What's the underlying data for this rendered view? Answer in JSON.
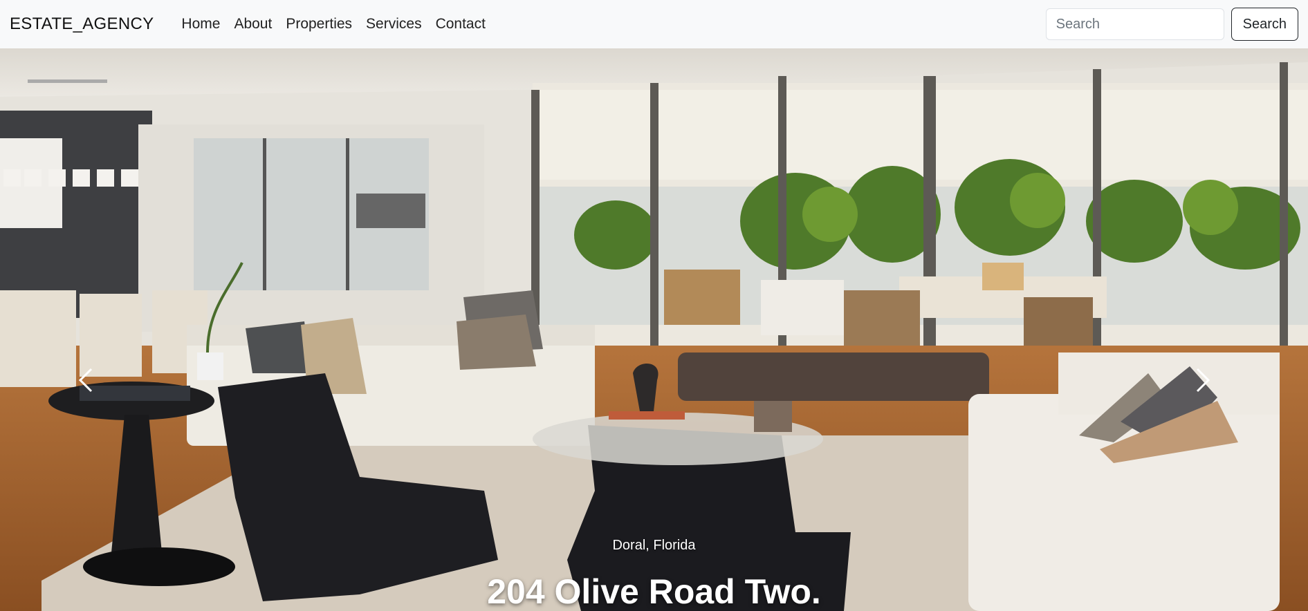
{
  "navbar": {
    "brand": "ESTATE_AGENCY",
    "links": [
      "Home",
      "About",
      "Properties",
      "Services",
      "Contact"
    ],
    "search_placeholder": "Search",
    "search_button": "Search"
  },
  "hero": {
    "location": "Doral, Florida",
    "title": "204 Olive Road Two.",
    "image": "living-room-photo",
    "icons": {
      "prev": "chevron-left-icon",
      "next": "chevron-right-icon"
    }
  }
}
